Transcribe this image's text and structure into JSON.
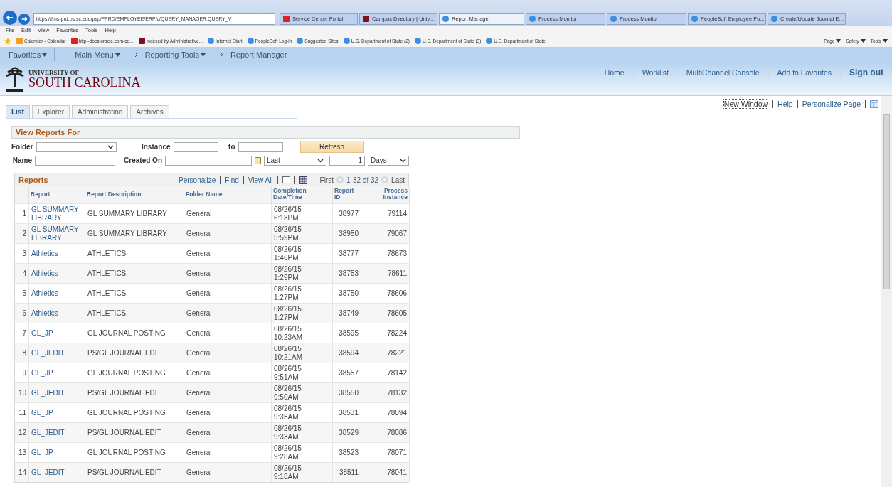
{
  "browser": {
    "url": "https://fms-prd.ps.sc.edu/psp/FPRD/EMPLOYEE/ERP/c/QUERY_MANAGER.QUERY_V",
    "tabs": [
      {
        "label": "Service Center Portal",
        "selected": false
      },
      {
        "label": "Campus Directory | Univ...",
        "selected": false
      },
      {
        "label": "Report Manager",
        "selected": true
      },
      {
        "label": "Process Monitor",
        "selected": false
      },
      {
        "label": "Process Monitor",
        "selected": false
      },
      {
        "label": "PeopleSoft Employee Po...",
        "selected": false
      },
      {
        "label": "Create/Update Journal E...",
        "selected": false
      }
    ],
    "menu": [
      "File",
      "Edit",
      "View",
      "Favorites",
      "Tools",
      "Help"
    ],
    "favorites": [
      "Calendar - Calendar",
      "http--docs.oracle.com-cd...",
      "Indexed by Administrative...",
      "Internet Start",
      "PeopleSoft Log-in",
      "Suggested Sites",
      "U.S. Department of State (2)",
      "U.S. Department of State (3)",
      "U.S. Department of State"
    ],
    "command_menus": [
      "Page",
      "Safety",
      "Tools"
    ]
  },
  "nav": {
    "favorites": "Favorites",
    "main_menu": "Main Menu",
    "breadcrumbs": [
      {
        "label": "Reporting Tools",
        "dropdown": true
      },
      {
        "label": "Report Manager",
        "dropdown": false
      }
    ]
  },
  "header": {
    "logo_top": "UNIVERSITY OF",
    "logo_bottom": "SOUTH CAROLINA",
    "links": [
      "Home",
      "Worklist",
      "MultiChannel Console",
      "Add to Favorites"
    ],
    "sign_out": "Sign out"
  },
  "page_links": [
    {
      "label": "New Window",
      "focused": true
    },
    {
      "label": "Help",
      "focused": false
    },
    {
      "label": "Personalize Page",
      "focused": false
    }
  ],
  "tabs": [
    {
      "label": "List",
      "selected": true
    },
    {
      "label": "Explorer",
      "selected": false
    },
    {
      "label": "Administration",
      "selected": false
    },
    {
      "label": "Archives",
      "selected": false
    }
  ],
  "filters": {
    "title": "View Reports For",
    "folder_label": "Folder",
    "instance_label": "Instance",
    "to_label": "to",
    "refresh": "Refresh",
    "name_label": "Name",
    "created_on_label": "Created On",
    "range": "Last",
    "count": "1",
    "unit": "Days"
  },
  "reports": {
    "title": "Reports",
    "tools": [
      "Personalize",
      "Find",
      "View All"
    ],
    "first": "First",
    "range": "1-32 of 32",
    "last": "Last",
    "columns": [
      "Report",
      "Report Description",
      "Folder Name",
      "Completion Date/Time",
      "Report ID",
      "Process Instance"
    ],
    "rows": [
      {
        "n": "1",
        "report": "GL SUMMARY LIBRARY",
        "description": "GL SUMMARY LIBRARY",
        "folder": "General",
        "date": "08/26/15",
        "time": "6:18PM",
        "id": "38977",
        "instance": "79114"
      },
      {
        "n": "2",
        "report": "GL SUMMARY LIBRARY",
        "description": "GL SUMMARY LIBRARY",
        "folder": "General",
        "date": "08/26/15",
        "time": "5:59PM",
        "id": "38950",
        "instance": "79067"
      },
      {
        "n": "3",
        "report": "Athletics",
        "description": "ATHLETICS",
        "folder": "General",
        "date": "08/26/15",
        "time": "1:46PM",
        "id": "38777",
        "instance": "78673"
      },
      {
        "n": "4",
        "report": "Athletics",
        "description": "ATHLETICS",
        "folder": "General",
        "date": "08/26/15",
        "time": "1:29PM",
        "id": "38753",
        "instance": "78611"
      },
      {
        "n": "5",
        "report": "Athletics",
        "description": "ATHLETICS",
        "folder": "General",
        "date": "08/26/15",
        "time": "1:27PM",
        "id": "38750",
        "instance": "78606"
      },
      {
        "n": "6",
        "report": "Athletics",
        "description": "ATHLETICS",
        "folder": "General",
        "date": "08/26/15",
        "time": "1:27PM",
        "id": "38749",
        "instance": "78605"
      },
      {
        "n": "7",
        "report": "GL_JP",
        "description": "GL JOURNAL POSTING",
        "folder": "General",
        "date": "08/26/15",
        "time": "10:23AM",
        "id": "38595",
        "instance": "78224"
      },
      {
        "n": "8",
        "report": "GL_JEDIT",
        "description": "PS/GL JOURNAL EDIT",
        "folder": "General",
        "date": "08/26/15",
        "time": "10:21AM",
        "id": "38594",
        "instance": "78221"
      },
      {
        "n": "9",
        "report": "GL_JP",
        "description": "GL JOURNAL POSTING",
        "folder": "General",
        "date": "08/26/15",
        "time": "9:51AM",
        "id": "38557",
        "instance": "78142"
      },
      {
        "n": "10",
        "report": "GL_JEDIT",
        "description": "PS/GL JOURNAL EDIT",
        "folder": "General",
        "date": "08/26/15",
        "time": "9:50AM",
        "id": "38550",
        "instance": "78132"
      },
      {
        "n": "11",
        "report": "GL_JP",
        "description": "GL JOURNAL POSTING",
        "folder": "General",
        "date": "08/26/15",
        "time": "9:35AM",
        "id": "38531",
        "instance": "78094"
      },
      {
        "n": "12",
        "report": "GL_JEDIT",
        "description": "PS/GL JOURNAL EDIT",
        "folder": "General",
        "date": "08/26/15",
        "time": "9:33AM",
        "id": "38529",
        "instance": "78086"
      },
      {
        "n": "13",
        "report": "GL_JP",
        "description": "GL JOURNAL POSTING",
        "folder": "General",
        "date": "08/26/15",
        "time": "9:28AM",
        "id": "38523",
        "instance": "78071"
      },
      {
        "n": "14",
        "report": "GL_JEDIT",
        "description": "PS/GL JOURNAL EDIT",
        "folder": "General",
        "date": "08/26/15",
        "time": "9:18AM",
        "id": "38511",
        "instance": "78041"
      }
    ]
  }
}
